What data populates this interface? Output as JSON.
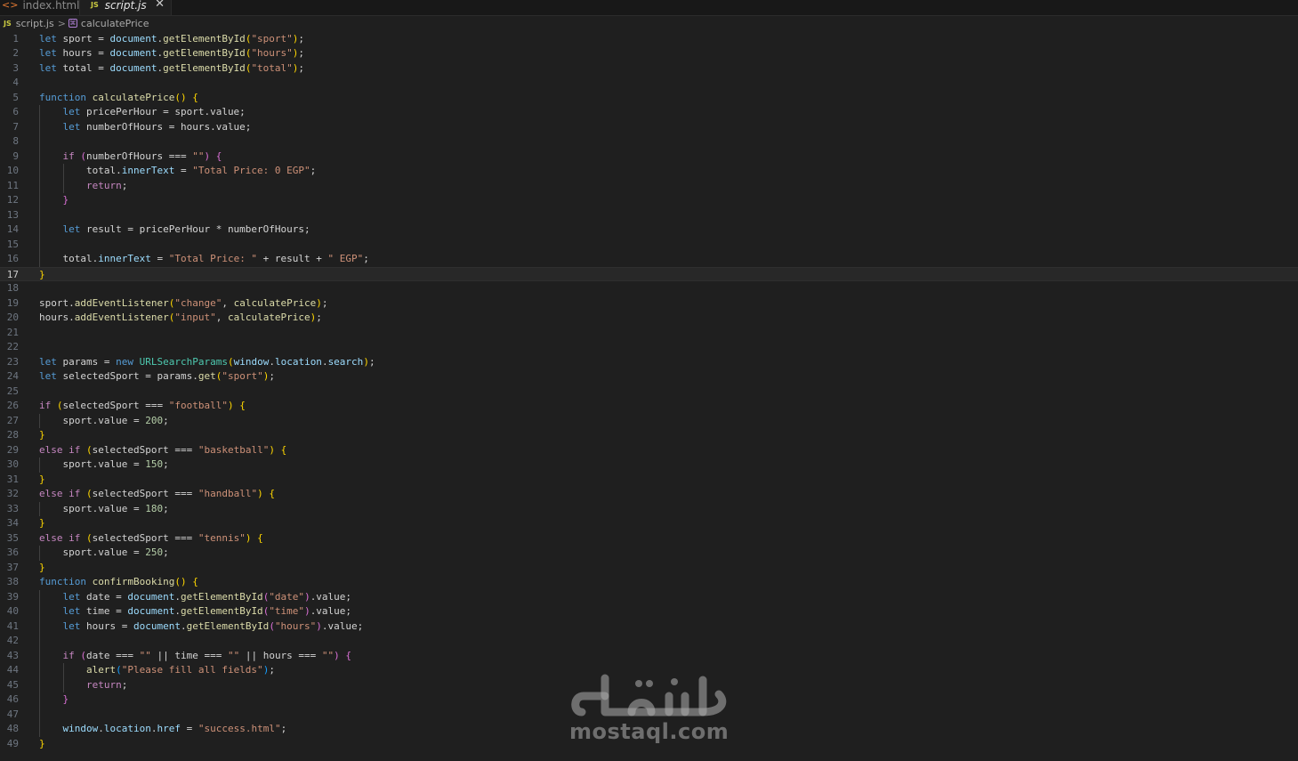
{
  "tabs": [
    {
      "label": "index.html",
      "icon": "html-file-icon",
      "active": false
    },
    {
      "label": "script.js",
      "icon": "js-file-icon",
      "active": true
    }
  ],
  "breadcrumb": {
    "file": "script.js",
    "file_icon_text": "JS",
    "separator": ">",
    "symbol": "calculatePrice"
  },
  "editor": {
    "current_line": 17,
    "lines": [
      [
        [
          "kw",
          "let"
        ],
        [
          "txt",
          " sport = "
        ],
        [
          "var",
          "document"
        ],
        [
          "txt",
          "."
        ],
        [
          "fn",
          "getElementById"
        ],
        [
          "p1",
          "("
        ],
        [
          "str",
          "\"sport\""
        ],
        [
          "p1",
          ")"
        ],
        [
          "txt",
          ";"
        ]
      ],
      [
        [
          "kw",
          "let"
        ],
        [
          "txt",
          " hours = "
        ],
        [
          "var",
          "document"
        ],
        [
          "txt",
          "."
        ],
        [
          "fn",
          "getElementById"
        ],
        [
          "p1",
          "("
        ],
        [
          "str",
          "\"hours\""
        ],
        [
          "p1",
          ")"
        ],
        [
          "txt",
          ";"
        ]
      ],
      [
        [
          "kw",
          "let"
        ],
        [
          "txt",
          " total = "
        ],
        [
          "var",
          "document"
        ],
        [
          "txt",
          "."
        ],
        [
          "fn",
          "getElementById"
        ],
        [
          "p1",
          "("
        ],
        [
          "str",
          "\"total\""
        ],
        [
          "p1",
          ")"
        ],
        [
          "txt",
          ";"
        ]
      ],
      [],
      [
        [
          "kw",
          "function"
        ],
        [
          "txt",
          " "
        ],
        [
          "fn",
          "calculatePrice"
        ],
        [
          "p1",
          "()"
        ],
        [
          "txt",
          " "
        ],
        [
          "p1",
          "{"
        ]
      ],
      [
        [
          "txt",
          "    "
        ],
        [
          "kw",
          "let"
        ],
        [
          "txt",
          " pricePerHour = sport.value;"
        ]
      ],
      [
        [
          "txt",
          "    "
        ],
        [
          "kw",
          "let"
        ],
        [
          "txt",
          " numberOfHours = hours.value;"
        ]
      ],
      [],
      [
        [
          "txt",
          "    "
        ],
        [
          "ctl",
          "if"
        ],
        [
          "txt",
          " "
        ],
        [
          "p2",
          "("
        ],
        [
          "txt",
          "numberOfHours === "
        ],
        [
          "str",
          "\"\""
        ],
        [
          "p2",
          ")"
        ],
        [
          "txt",
          " "
        ],
        [
          "p2",
          "{"
        ]
      ],
      [
        [
          "txt",
          "        total."
        ],
        [
          "var",
          "innerText"
        ],
        [
          "txt",
          " = "
        ],
        [
          "str",
          "\"Total Price: 0 EGP\""
        ],
        [
          "txt",
          ";"
        ]
      ],
      [
        [
          "txt",
          "        "
        ],
        [
          "ctl",
          "return"
        ],
        [
          "txt",
          ";"
        ]
      ],
      [
        [
          "txt",
          "    "
        ],
        [
          "p2",
          "}"
        ]
      ],
      [],
      [
        [
          "txt",
          "    "
        ],
        [
          "kw",
          "let"
        ],
        [
          "txt",
          " result = pricePerHour * numberOfHours;"
        ]
      ],
      [],
      [
        [
          "txt",
          "    total."
        ],
        [
          "var",
          "innerText"
        ],
        [
          "txt",
          " = "
        ],
        [
          "str",
          "\"Total Price: \""
        ],
        [
          "txt",
          " + result + "
        ],
        [
          "str",
          "\" EGP\""
        ],
        [
          "txt",
          ";"
        ]
      ],
      [
        [
          "p1",
          "}"
        ]
      ],
      [],
      [
        [
          "txt",
          "sport."
        ],
        [
          "fn",
          "addEventListener"
        ],
        [
          "p1",
          "("
        ],
        [
          "str",
          "\"change\""
        ],
        [
          "txt",
          ", "
        ],
        [
          "fn",
          "calculatePrice"
        ],
        [
          "p1",
          ")"
        ],
        [
          "txt",
          ";"
        ]
      ],
      [
        [
          "txt",
          "hours."
        ],
        [
          "fn",
          "addEventListener"
        ],
        [
          "p1",
          "("
        ],
        [
          "str",
          "\"input\""
        ],
        [
          "txt",
          ", "
        ],
        [
          "fn",
          "calculatePrice"
        ],
        [
          "p1",
          ")"
        ],
        [
          "txt",
          ";"
        ]
      ],
      [],
      [],
      [
        [
          "kw",
          "let"
        ],
        [
          "txt",
          " params = "
        ],
        [
          "kw",
          "new"
        ],
        [
          "txt",
          " "
        ],
        [
          "cls",
          "URLSearchParams"
        ],
        [
          "p1",
          "("
        ],
        [
          "var",
          "window"
        ],
        [
          "txt",
          "."
        ],
        [
          "var",
          "location"
        ],
        [
          "txt",
          "."
        ],
        [
          "var",
          "search"
        ],
        [
          "p1",
          ")"
        ],
        [
          "txt",
          ";"
        ]
      ],
      [
        [
          "kw",
          "let"
        ],
        [
          "txt",
          " selectedSport = params."
        ],
        [
          "fn",
          "get"
        ],
        [
          "p1",
          "("
        ],
        [
          "str",
          "\"sport\""
        ],
        [
          "p1",
          ")"
        ],
        [
          "txt",
          ";"
        ]
      ],
      [],
      [
        [
          "ctl",
          "if"
        ],
        [
          "txt",
          " "
        ],
        [
          "p1",
          "("
        ],
        [
          "txt",
          "selectedSport === "
        ],
        [
          "str",
          "\"football\""
        ],
        [
          "p1",
          ")"
        ],
        [
          "txt",
          " "
        ],
        [
          "p1",
          "{"
        ]
      ],
      [
        [
          "txt",
          "    sport.value = "
        ],
        [
          "num",
          "200"
        ],
        [
          "txt",
          ";"
        ]
      ],
      [
        [
          "p1",
          "}"
        ]
      ],
      [
        [
          "ctl",
          "else"
        ],
        [
          "txt",
          " "
        ],
        [
          "ctl",
          "if"
        ],
        [
          "txt",
          " "
        ],
        [
          "p1",
          "("
        ],
        [
          "txt",
          "selectedSport === "
        ],
        [
          "str",
          "\"basketball\""
        ],
        [
          "p1",
          ")"
        ],
        [
          "txt",
          " "
        ],
        [
          "p1",
          "{"
        ]
      ],
      [
        [
          "txt",
          "    sport.value = "
        ],
        [
          "num",
          "150"
        ],
        [
          "txt",
          ";"
        ]
      ],
      [
        [
          "p1",
          "}"
        ]
      ],
      [
        [
          "ctl",
          "else"
        ],
        [
          "txt",
          " "
        ],
        [
          "ctl",
          "if"
        ],
        [
          "txt",
          " "
        ],
        [
          "p1",
          "("
        ],
        [
          "txt",
          "selectedSport === "
        ],
        [
          "str",
          "\"handball\""
        ],
        [
          "p1",
          ")"
        ],
        [
          "txt",
          " "
        ],
        [
          "p1",
          "{"
        ]
      ],
      [
        [
          "txt",
          "    sport.value = "
        ],
        [
          "num",
          "180"
        ],
        [
          "txt",
          ";"
        ]
      ],
      [
        [
          "p1",
          "}"
        ]
      ],
      [
        [
          "ctl",
          "else"
        ],
        [
          "txt",
          " "
        ],
        [
          "ctl",
          "if"
        ],
        [
          "txt",
          " "
        ],
        [
          "p1",
          "("
        ],
        [
          "txt",
          "selectedSport === "
        ],
        [
          "str",
          "\"tennis\""
        ],
        [
          "p1",
          ")"
        ],
        [
          "txt",
          " "
        ],
        [
          "p1",
          "{"
        ]
      ],
      [
        [
          "txt",
          "    sport.value = "
        ],
        [
          "num",
          "250"
        ],
        [
          "txt",
          ";"
        ]
      ],
      [
        [
          "p1",
          "}"
        ]
      ],
      [
        [
          "kw",
          "function"
        ],
        [
          "txt",
          " "
        ],
        [
          "fn",
          "confirmBooking"
        ],
        [
          "p1",
          "()"
        ],
        [
          "txt",
          " "
        ],
        [
          "p1",
          "{"
        ]
      ],
      [
        [
          "txt",
          "    "
        ],
        [
          "kw",
          "let"
        ],
        [
          "txt",
          " date = "
        ],
        [
          "var",
          "document"
        ],
        [
          "txt",
          "."
        ],
        [
          "fn",
          "getElementById"
        ],
        [
          "p2",
          "("
        ],
        [
          "str",
          "\"date\""
        ],
        [
          "p2",
          ")"
        ],
        [
          "txt",
          ".value;"
        ]
      ],
      [
        [
          "txt",
          "    "
        ],
        [
          "kw",
          "let"
        ],
        [
          "txt",
          " time = "
        ],
        [
          "var",
          "document"
        ],
        [
          "txt",
          "."
        ],
        [
          "fn",
          "getElementById"
        ],
        [
          "p2",
          "("
        ],
        [
          "str",
          "\"time\""
        ],
        [
          "p2",
          ")"
        ],
        [
          "txt",
          ".value;"
        ]
      ],
      [
        [
          "txt",
          "    "
        ],
        [
          "kw",
          "let"
        ],
        [
          "txt",
          " hours = "
        ],
        [
          "var",
          "document"
        ],
        [
          "txt",
          "."
        ],
        [
          "fn",
          "getElementById"
        ],
        [
          "p2",
          "("
        ],
        [
          "str",
          "\"hours\""
        ],
        [
          "p2",
          ")"
        ],
        [
          "txt",
          ".value;"
        ]
      ],
      [],
      [
        [
          "txt",
          "    "
        ],
        [
          "ctl",
          "if"
        ],
        [
          "txt",
          " "
        ],
        [
          "p2",
          "("
        ],
        [
          "txt",
          "date === "
        ],
        [
          "str",
          "\"\""
        ],
        [
          "txt",
          " || time === "
        ],
        [
          "str",
          "\"\""
        ],
        [
          "txt",
          " || hours === "
        ],
        [
          "str",
          "\"\""
        ],
        [
          "p2",
          ")"
        ],
        [
          "txt",
          " "
        ],
        [
          "p2",
          "{"
        ]
      ],
      [
        [
          "txt",
          "        "
        ],
        [
          "fn",
          "alert"
        ],
        [
          "p3",
          "("
        ],
        [
          "str",
          "\"Please fill all fields\""
        ],
        [
          "p3",
          ")"
        ],
        [
          "txt",
          ";"
        ]
      ],
      [
        [
          "txt",
          "        "
        ],
        [
          "ctl",
          "return"
        ],
        [
          "txt",
          ";"
        ]
      ],
      [
        [
          "txt",
          "    "
        ],
        [
          "p2",
          "}"
        ]
      ],
      [],
      [
        [
          "txt",
          "    "
        ],
        [
          "var",
          "window"
        ],
        [
          "txt",
          "."
        ],
        [
          "var",
          "location"
        ],
        [
          "txt",
          "."
        ],
        [
          "var",
          "href"
        ],
        [
          "txt",
          " = "
        ],
        [
          "str",
          "\"success.html\""
        ],
        [
          "txt",
          ";"
        ]
      ],
      [
        [
          "p1",
          "}"
        ]
      ]
    ]
  },
  "watermark": {
    "logo_text": "مستقل",
    "site": "mostaql.com"
  },
  "colors": {
    "background": "#1f1f1f",
    "keyword": "#569cd6",
    "control": "#c586c0",
    "function": "#dcdcaa",
    "string": "#ce9178",
    "number": "#b5cea8",
    "variable": "#9cdcfe",
    "class": "#4ec9b0",
    "bracket1": "#ffd700",
    "bracket2": "#da70d6",
    "bracket3": "#179fff"
  }
}
